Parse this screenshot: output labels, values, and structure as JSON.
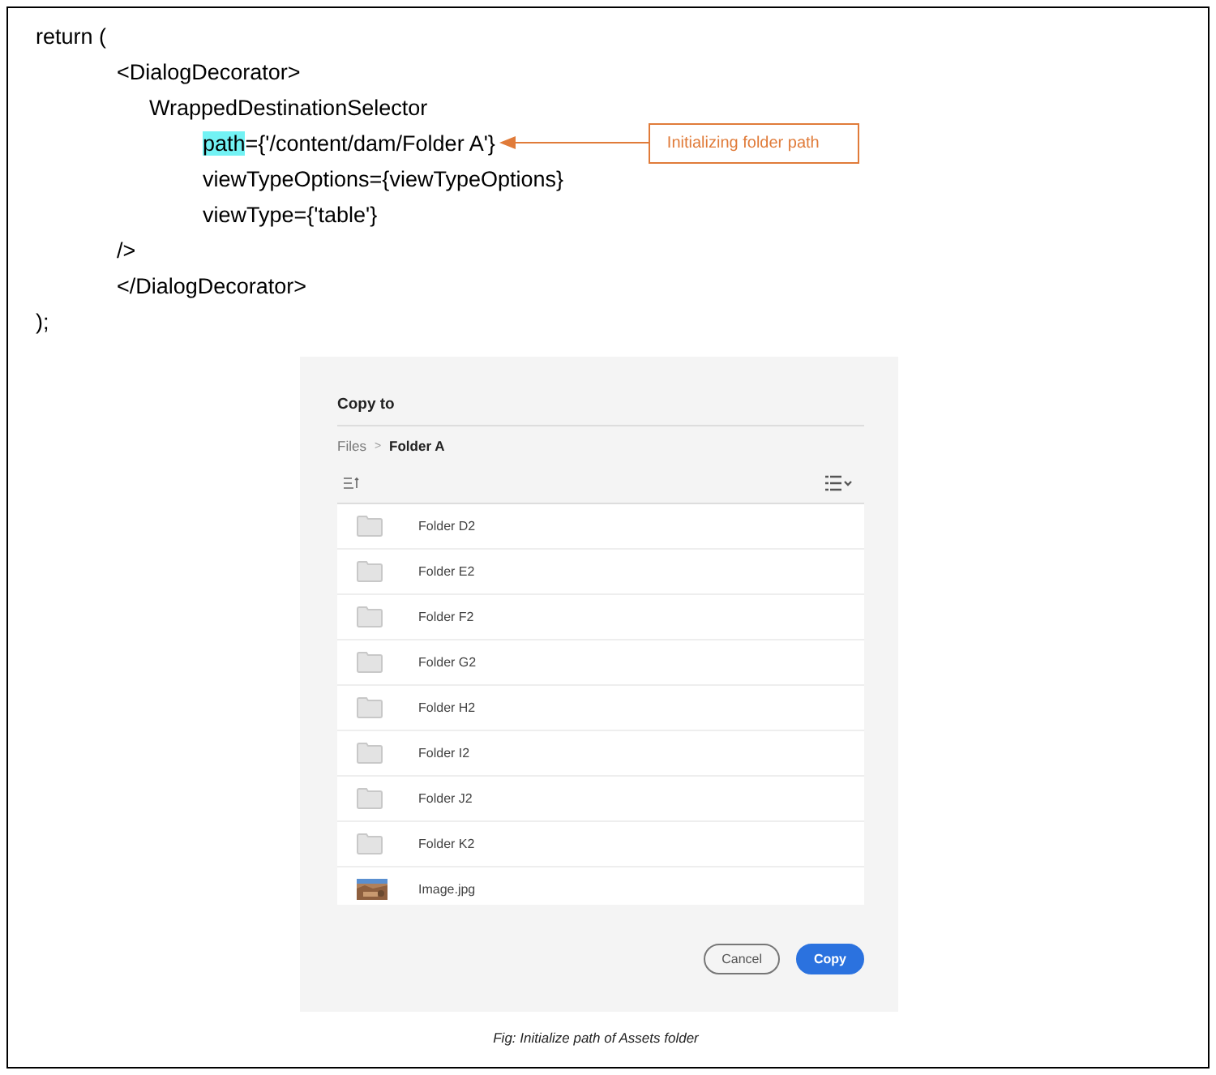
{
  "code": [
    {
      "kind": "outer",
      "text": "return ("
    },
    {
      "kind": "tag",
      "text": "<DialogDecorator>"
    },
    {
      "kind": "component",
      "text": "WrappedDestinationSelector"
    },
    {
      "kind": "attr",
      "highlight": "path",
      "text": "={'/content/dam/Folder A'}",
      "callout": "Initializing folder path"
    },
    {
      "kind": "attr",
      "text": "viewTypeOptions={viewTypeOptions}"
    },
    {
      "kind": "attr",
      "text": "viewType={'table'}"
    },
    {
      "kind": "tag",
      "text": "/>"
    },
    {
      "kind": "tag",
      "text": "</DialogDecorator>"
    },
    {
      "kind": "outer",
      "text": ");"
    }
  ],
  "dialog": {
    "title": "Copy to",
    "breadcrumb": [
      "Files",
      "Folder A"
    ],
    "separator": ">",
    "rows": [
      {
        "kind": "folder",
        "name": "Folder D2"
      },
      {
        "kind": "folder",
        "name": "Folder E2"
      },
      {
        "kind": "folder",
        "name": "Folder F2"
      },
      {
        "kind": "folder",
        "name": "Folder G2"
      },
      {
        "kind": "folder",
        "name": "Folder H2"
      },
      {
        "kind": "folder",
        "name": "Folder I2"
      },
      {
        "kind": "folder",
        "name": "Folder J2"
      },
      {
        "kind": "folder",
        "name": "Folder K2"
      },
      {
        "name": "Image.jpg"
      }
    ],
    "buttons": [
      {
        "kind": "secondary",
        "label": "Cancel"
      },
      {
        "kind": "primary",
        "label": "Copy"
      }
    ]
  },
  "caption": "Fig: Initialize path of Assets folder"
}
